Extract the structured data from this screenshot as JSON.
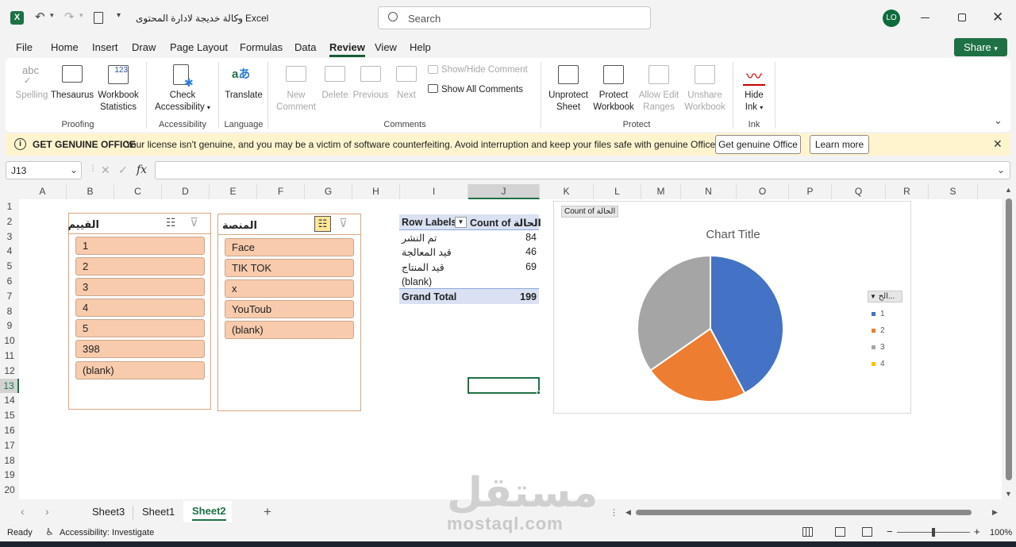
{
  "titlebar": {
    "file_name": "وكالة خديجة لادارة المحتوى",
    "separator": "-",
    "app": "Excel",
    "search_placeholder": "Search",
    "user_initials": "LO"
  },
  "menu": {
    "items": [
      "File",
      "Home",
      "Insert",
      "Draw",
      "Page Layout",
      "Formulas",
      "Data",
      "Review",
      "View",
      "Help"
    ],
    "active": "Review",
    "share": "Share"
  },
  "ribbon": {
    "proofing": {
      "spelling": "Spelling",
      "thesaurus": "Thesaurus",
      "workbook_statistics": [
        "Workbook",
        "Statistics"
      ],
      "label": "Proofing"
    },
    "accessibility": {
      "check": [
        "Check",
        "Accessibility"
      ],
      "label": "Accessibility"
    },
    "language": {
      "translate": "Translate",
      "label": "Language"
    },
    "comments": {
      "new": [
        "New",
        "Comment"
      ],
      "delete": "Delete",
      "previous": "Previous",
      "next": "Next",
      "show_hide": "Show/Hide Comment",
      "show_all": "Show All Comments",
      "label": "Comments"
    },
    "protect": {
      "unprotect_sheet": [
        "Unprotect",
        "Sheet"
      ],
      "protect_workbook": [
        "Protect",
        "Workbook"
      ],
      "allow_edit": [
        "Allow Edit",
        "Ranges"
      ],
      "unshare": [
        "Unshare",
        "Workbook"
      ],
      "label": "Protect"
    },
    "ink": {
      "hide": [
        "Hide",
        "Ink"
      ],
      "label": "Ink"
    }
  },
  "genuine": {
    "title": "GET GENUINE OFFICE",
    "message": "Your license isn't genuine, and you may be a victim of software counterfeiting. Avoid interruption and keep your files safe with genuine Office today.",
    "button": "Get genuine Office",
    "learn": "Learn more"
  },
  "formula": {
    "name_box": "J13",
    "fx": "fx",
    "value": ""
  },
  "columns": [
    "A",
    "B",
    "C",
    "D",
    "E",
    "F",
    "G",
    "H",
    "I",
    "J",
    "K",
    "L",
    "M",
    "N",
    "O",
    "P",
    "Q",
    "R",
    "S"
  ],
  "rows": [
    "1",
    "2",
    "3",
    "4",
    "5",
    "6",
    "7",
    "8",
    "9",
    "10",
    "11",
    "12",
    "13",
    "14",
    "15",
    "16",
    "17",
    "18",
    "19",
    "20"
  ],
  "slicer1": {
    "title": "القييم",
    "items": [
      "1",
      "2",
      "3",
      "4",
      "5",
      "398",
      "(blank)"
    ]
  },
  "slicer2": {
    "title": "المنصة",
    "items": [
      "Face",
      "TIK TOK",
      "x",
      "YouToub",
      "(blank)"
    ]
  },
  "pivot": {
    "header_row": "Row Labels",
    "header_value": "Count of الحالة",
    "rows": [
      {
        "label": "تم النشر",
        "value": "84"
      },
      {
        "label": "قيد المعالجة",
        "value": "46"
      },
      {
        "label": "قيد المنتاج",
        "value": "69"
      },
      {
        "label": "(blank)",
        "value": ""
      }
    ],
    "total_label": "Grand Total",
    "total_value": "199"
  },
  "chart_data": {
    "type": "pie",
    "title": "Chart Title",
    "field_button": "Count of الحالة",
    "legend_header": "الح...",
    "legend_position": "right",
    "categories": [
      "1",
      "2",
      "3",
      "4"
    ],
    "values": [
      84,
      46,
      69,
      0
    ],
    "colors": [
      "#4472c4",
      "#ed7d31",
      "#a5a5a5",
      "#ffc000"
    ]
  },
  "sheets": {
    "tabs": [
      "Sheet3",
      "Sheet1",
      "Sheet2"
    ],
    "active": "Sheet2",
    "add": "+"
  },
  "status": {
    "ready": "Ready",
    "accessibility": "Accessibility: Investigate",
    "zoom": "100%",
    "minus": "−",
    "plus": "+"
  },
  "watermark": {
    "text": "mostaql.com"
  }
}
